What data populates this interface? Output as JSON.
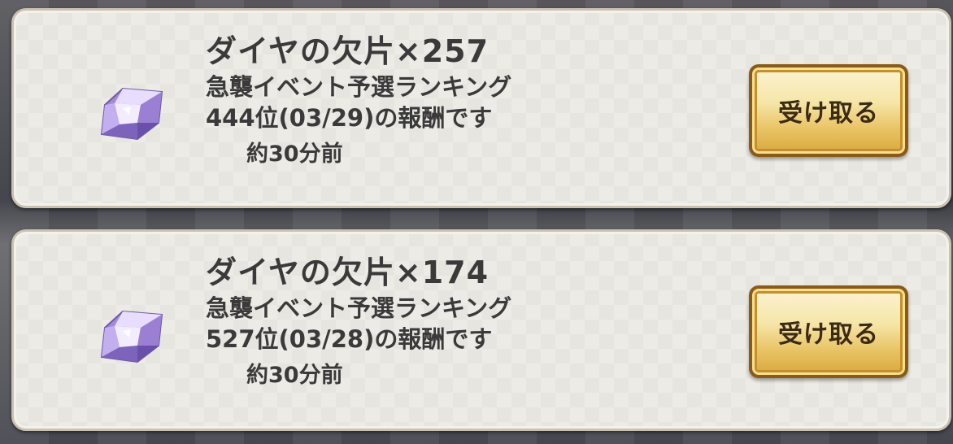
{
  "rewards": [
    {
      "item": "ダイヤの欠片×257",
      "source": "急襲イベント予選ランキング",
      "detail": "444位(03/29)の報酬です",
      "time": "約30分前",
      "button": "受け取る",
      "icon": "diamond-fragment-icon"
    },
    {
      "item": "ダイヤの欠片×174",
      "source": "急襲イベント予選ランキング",
      "detail": "527位(03/28)の報酬です",
      "time": "約30分前",
      "button": "受け取る",
      "icon": "diamond-fragment-icon"
    }
  ],
  "colors": {
    "card": "#ecebe5",
    "text": "#3a3a3a",
    "button_gold": "#e9c567",
    "button_border": "#8a5a16",
    "gem": "#b9a3ea"
  }
}
